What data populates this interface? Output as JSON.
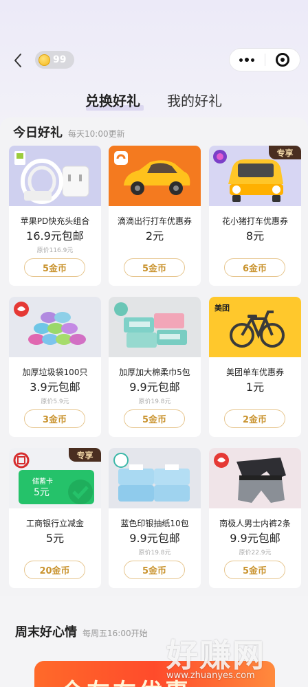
{
  "header": {
    "coin_count": "99"
  },
  "tabs": [
    {
      "label": "兑换好礼",
      "active": true
    },
    {
      "label": "我的好礼",
      "active": false
    }
  ],
  "today": {
    "title": "今日好礼",
    "subtitle": "每天10:00更新",
    "items": [
      {
        "name": "苹果PD快充头组合",
        "price": "16.9元包邮",
        "original": "原价116.9元",
        "cost": "5金币",
        "badge": ""
      },
      {
        "name": "滴滴出行打车优惠券",
        "price": "2元",
        "original": "",
        "cost": "5金币",
        "badge": ""
      },
      {
        "name": "花小猪打车优惠券",
        "price": "8元",
        "original": "",
        "cost": "6金币",
        "badge": "专享"
      },
      {
        "name": "加厚垃圾袋100只",
        "price": "3.9元包邮",
        "original": "原价5.9元",
        "cost": "3金币",
        "badge": ""
      },
      {
        "name": "加厚加大棉柔巾5包",
        "price": "9.9元包邮",
        "original": "原价19.8元",
        "cost": "5金币",
        "badge": ""
      },
      {
        "name": "美团单车优惠券",
        "price": "1元",
        "original": "",
        "cost": "2金币",
        "badge": ""
      },
      {
        "name": "工商银行立减金",
        "price": "5元",
        "original": "",
        "cost": "20金币",
        "badge": "专享"
      },
      {
        "name": "蓝色印银抽纸10包",
        "price": "9.9元包邮",
        "original": "原价19.8元",
        "cost": "5金币",
        "badge": ""
      },
      {
        "name": "南极人男士内裤2条",
        "price": "9.9元包邮",
        "original": "原价22.9元",
        "cost": "5金币",
        "badge": ""
      }
    ]
  },
  "image_text": {
    "meituan_logo": "美团",
    "icbc_card_title": "储蓄卡",
    "icbc_card_amount": "5元"
  },
  "weekend": {
    "title": "周末好心情",
    "subtitle": "每周五16:00开始"
  },
  "banner": {
    "text": "全左右优惠"
  },
  "watermark": {
    "main": "好赚网",
    "url": "www.zhuanyes.com"
  }
}
